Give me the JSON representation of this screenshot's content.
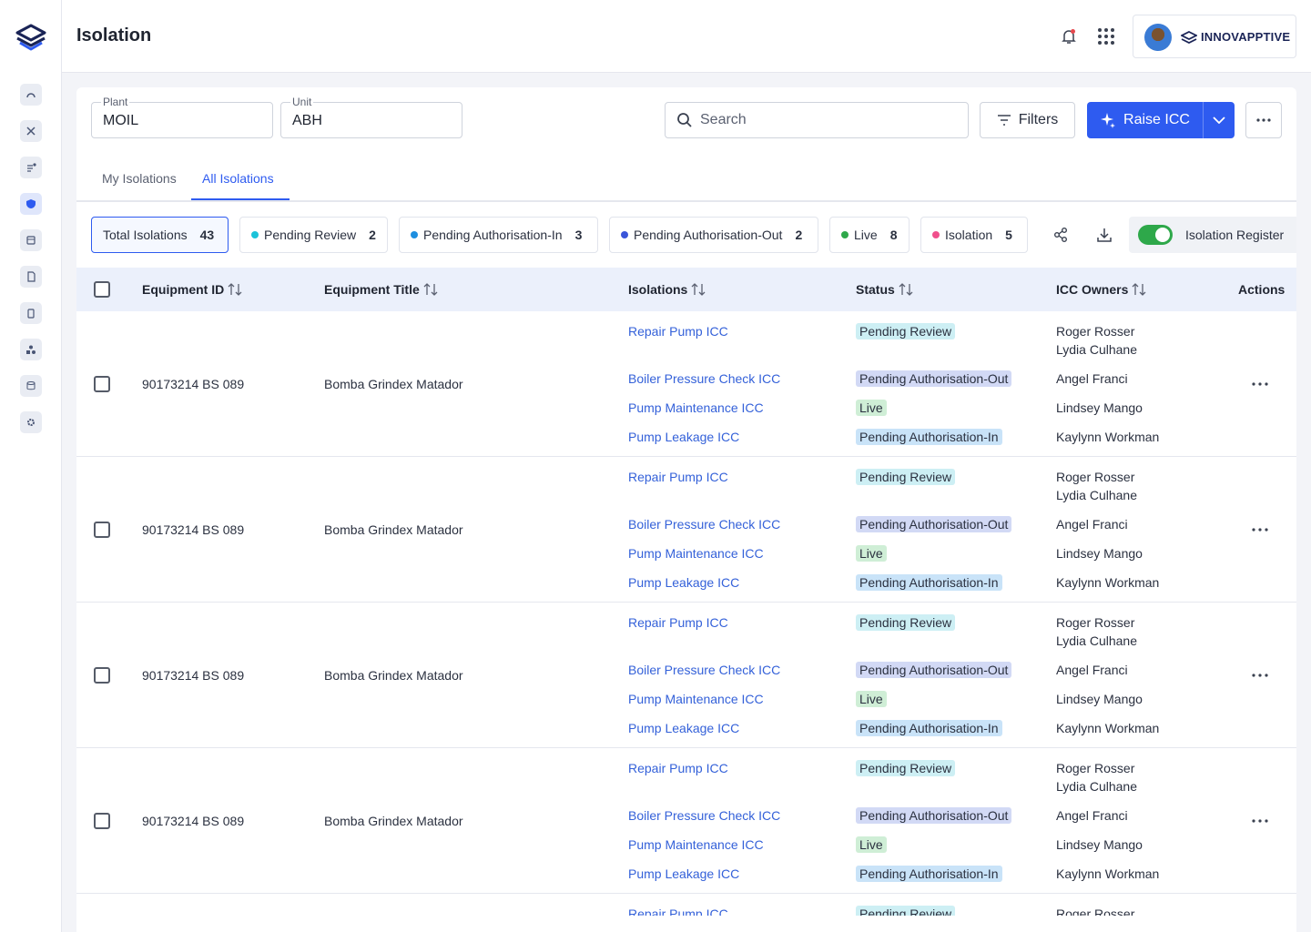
{
  "header": {
    "title": "Isolation",
    "brand": "INNOVAPPTIVE"
  },
  "sidebar": {
    "icons": [
      "dashboard-icon",
      "tools-icon",
      "list-icon",
      "shield-icon",
      "calendar-icon",
      "document-icon",
      "clipboard-icon",
      "shapes-icon",
      "database-icon",
      "gear-icon"
    ]
  },
  "filters": {
    "plant_label": "Plant",
    "plant_value": "MOIL",
    "unit_label": "Unit",
    "unit_value": "ABH",
    "search_placeholder": "Search",
    "filters_label": "Filters",
    "raise_label": "Raise ICC"
  },
  "tabs": [
    {
      "label": "My Isolations"
    },
    {
      "label": "All Isolations"
    }
  ],
  "chips": [
    {
      "label": "Total Isolations",
      "count": "43"
    },
    {
      "label": "Pending Review",
      "count": "2",
      "color": "#1bc3d9"
    },
    {
      "label": "Pending Authorisation-In",
      "count": "3",
      "color": "#1e8fe0"
    },
    {
      "label": "Pending Authorisation-Out",
      "count": "2",
      "color": "#3a55d9"
    },
    {
      "label": "Live",
      "count": "8",
      "color": "#2ea84a"
    },
    {
      "label": "Isolation",
      "count": "5",
      "color": "#f0508c"
    }
  ],
  "register_label": "Isolation Register",
  "table": {
    "headers": {
      "equipment_id": "Equipment ID",
      "equipment_title": "Equipment Title",
      "isolations": "Isolations",
      "status": "Status",
      "owners": "ICC Owners",
      "actions": "Actions"
    },
    "rows": [
      {
        "equipment_id": "90173214 BS 089",
        "equipment_title": "Bomba Grindex Matador",
        "items": [
          {
            "isolation": "Repair Pump ICC",
            "status": "Pending Review",
            "owner1": "Roger Rosser",
            "owner2": "Lydia Culhane"
          },
          {
            "isolation": "Boiler Pressure Check ICC",
            "status": "Pending Authorisation-Out",
            "owner1": "Angel Franci"
          },
          {
            "isolation": "Pump Maintenance ICC",
            "status": "Live",
            "owner1": "Lindsey Mango"
          },
          {
            "isolation": "Pump Leakage ICC",
            "status": "Pending Authorisation-In",
            "owner1": "Kaylynn Workman"
          }
        ]
      },
      {
        "equipment_id": "90173214 BS 089",
        "equipment_title": "Bomba Grindex Matador",
        "items": [
          {
            "isolation": "Repair Pump ICC",
            "status": "Pending Review",
            "owner1": "Roger Rosser",
            "owner2": "Lydia Culhane"
          },
          {
            "isolation": "Boiler Pressure Check ICC",
            "status": "Pending Authorisation-Out",
            "owner1": "Angel Franci"
          },
          {
            "isolation": "Pump Maintenance ICC",
            "status": "Live",
            "owner1": "Lindsey Mango"
          },
          {
            "isolation": "Pump Leakage ICC",
            "status": "Pending Authorisation-In",
            "owner1": "Kaylynn Workman"
          }
        ]
      },
      {
        "equipment_id": "90173214 BS 089",
        "equipment_title": "Bomba Grindex Matador",
        "items": [
          {
            "isolation": "Repair Pump ICC",
            "status": "Pending Review",
            "owner1": "Roger Rosser",
            "owner2": "Lydia Culhane"
          },
          {
            "isolation": "Boiler Pressure Check ICC",
            "status": "Pending Authorisation-Out",
            "owner1": "Angel Franci"
          },
          {
            "isolation": "Pump Maintenance ICC",
            "status": "Live",
            "owner1": "Lindsey Mango"
          },
          {
            "isolation": "Pump Leakage ICC",
            "status": "Pending Authorisation-In",
            "owner1": "Kaylynn Workman"
          }
        ]
      },
      {
        "equipment_id": "90173214 BS 089",
        "equipment_title": "Bomba Grindex Matador",
        "items": [
          {
            "isolation": "Repair Pump ICC",
            "status": "Pending Review",
            "owner1": "Roger Rosser",
            "owner2": "Lydia Culhane"
          },
          {
            "isolation": "Boiler Pressure Check ICC",
            "status": "Pending Authorisation-Out",
            "owner1": "Angel Franci"
          },
          {
            "isolation": "Pump Maintenance ICC",
            "status": "Live",
            "owner1": "Lindsey Mango"
          },
          {
            "isolation": "Pump Leakage ICC",
            "status": "Pending Authorisation-In",
            "owner1": "Kaylynn Workman"
          }
        ]
      },
      {
        "equipment_id": "",
        "equipment_title": "",
        "items": [
          {
            "isolation": "Repair Pump ICC",
            "status": "Pending Review",
            "owner1": "Roger Rosser",
            "owner2": ""
          }
        ]
      }
    ]
  },
  "status_colors": {
    "Pending Review": "#cdeff4",
    "Pending Authorisation-Out": "#d2d9f5",
    "Live": "#cfeed6",
    "Pending Authorisation-In": "#c9e3f8"
  }
}
